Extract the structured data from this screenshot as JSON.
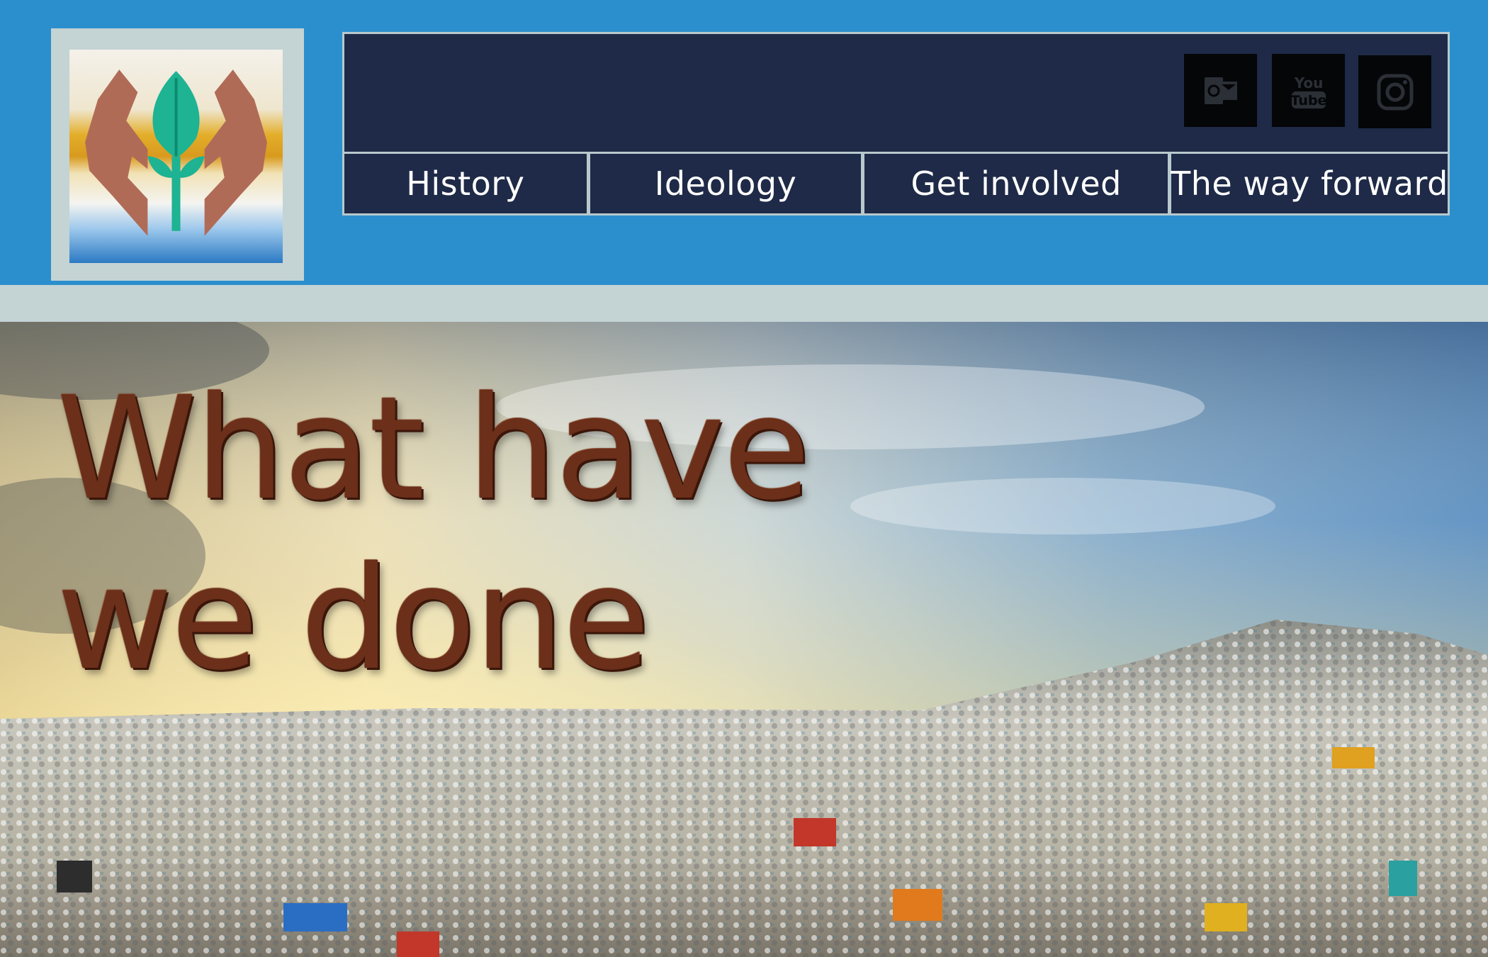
{
  "logo": {
    "icon": "hands-leaf-logo-icon"
  },
  "social": [
    {
      "name": "outlook-icon"
    },
    {
      "name": "youtube-icon",
      "label": "You Tube"
    },
    {
      "name": "instagram-icon"
    }
  ],
  "nav": {
    "items": [
      {
        "label": "History"
      },
      {
        "label": "Ideology"
      },
      {
        "label": "Get involved"
      },
      {
        "label": "The way forward"
      }
    ]
  },
  "hero": {
    "title": "What have we done"
  },
  "colors": {
    "header_bg": "#2b8fce",
    "banner_bg": "#1e2a47",
    "strip_bg": "#c4d3d4",
    "title_color": "#6b2f1a"
  }
}
